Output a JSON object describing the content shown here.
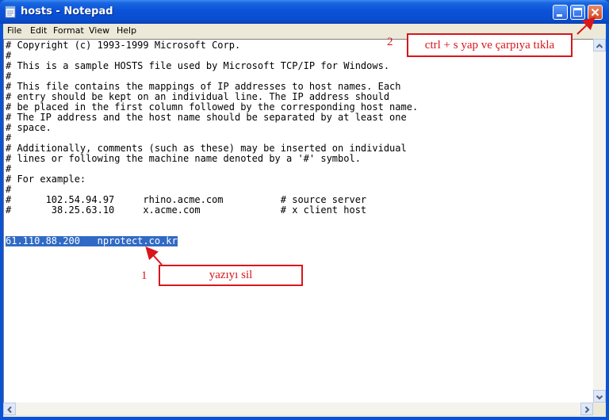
{
  "window": {
    "title": "hosts - Notepad"
  },
  "menu": [
    "File",
    "Edit",
    "Format",
    "View",
    "Help"
  ],
  "document": {
    "lines": [
      "# Copyright (c) 1993-1999 Microsoft Corp.",
      "#",
      "# This is a sample HOSTS file used by Microsoft TCP/IP for Windows.",
      "#",
      "# This file contains the mappings of IP addresses to host names. Each",
      "# entry should be kept on an individual line. The IP address should",
      "# be placed in the first column followed by the corresponding host name.",
      "# The IP address and the host name should be separated by at least one",
      "# space.",
      "#",
      "# Additionally, comments (such as these) may be inserted on individual",
      "# lines or following the machine name denoted by a '#' symbol.",
      "#",
      "# For example:",
      "#",
      "#      102.54.94.97     rhino.acme.com          # source server",
      "#       38.25.63.10     x.acme.com              # x client host",
      "",
      ""
    ],
    "selected_line": "61.110.88.200   nprotect.co.kr"
  },
  "annotations": {
    "step1_number": "1",
    "step1_text": "yazıyı sil",
    "step2_number": "2",
    "step2_text": "ctrl + s yap ve çarpıya tıkla",
    "color": "#d9161c"
  },
  "colors": {
    "titlebar": "#0a52d8",
    "selection": "#316ac5",
    "close_button": "#d34a22"
  }
}
